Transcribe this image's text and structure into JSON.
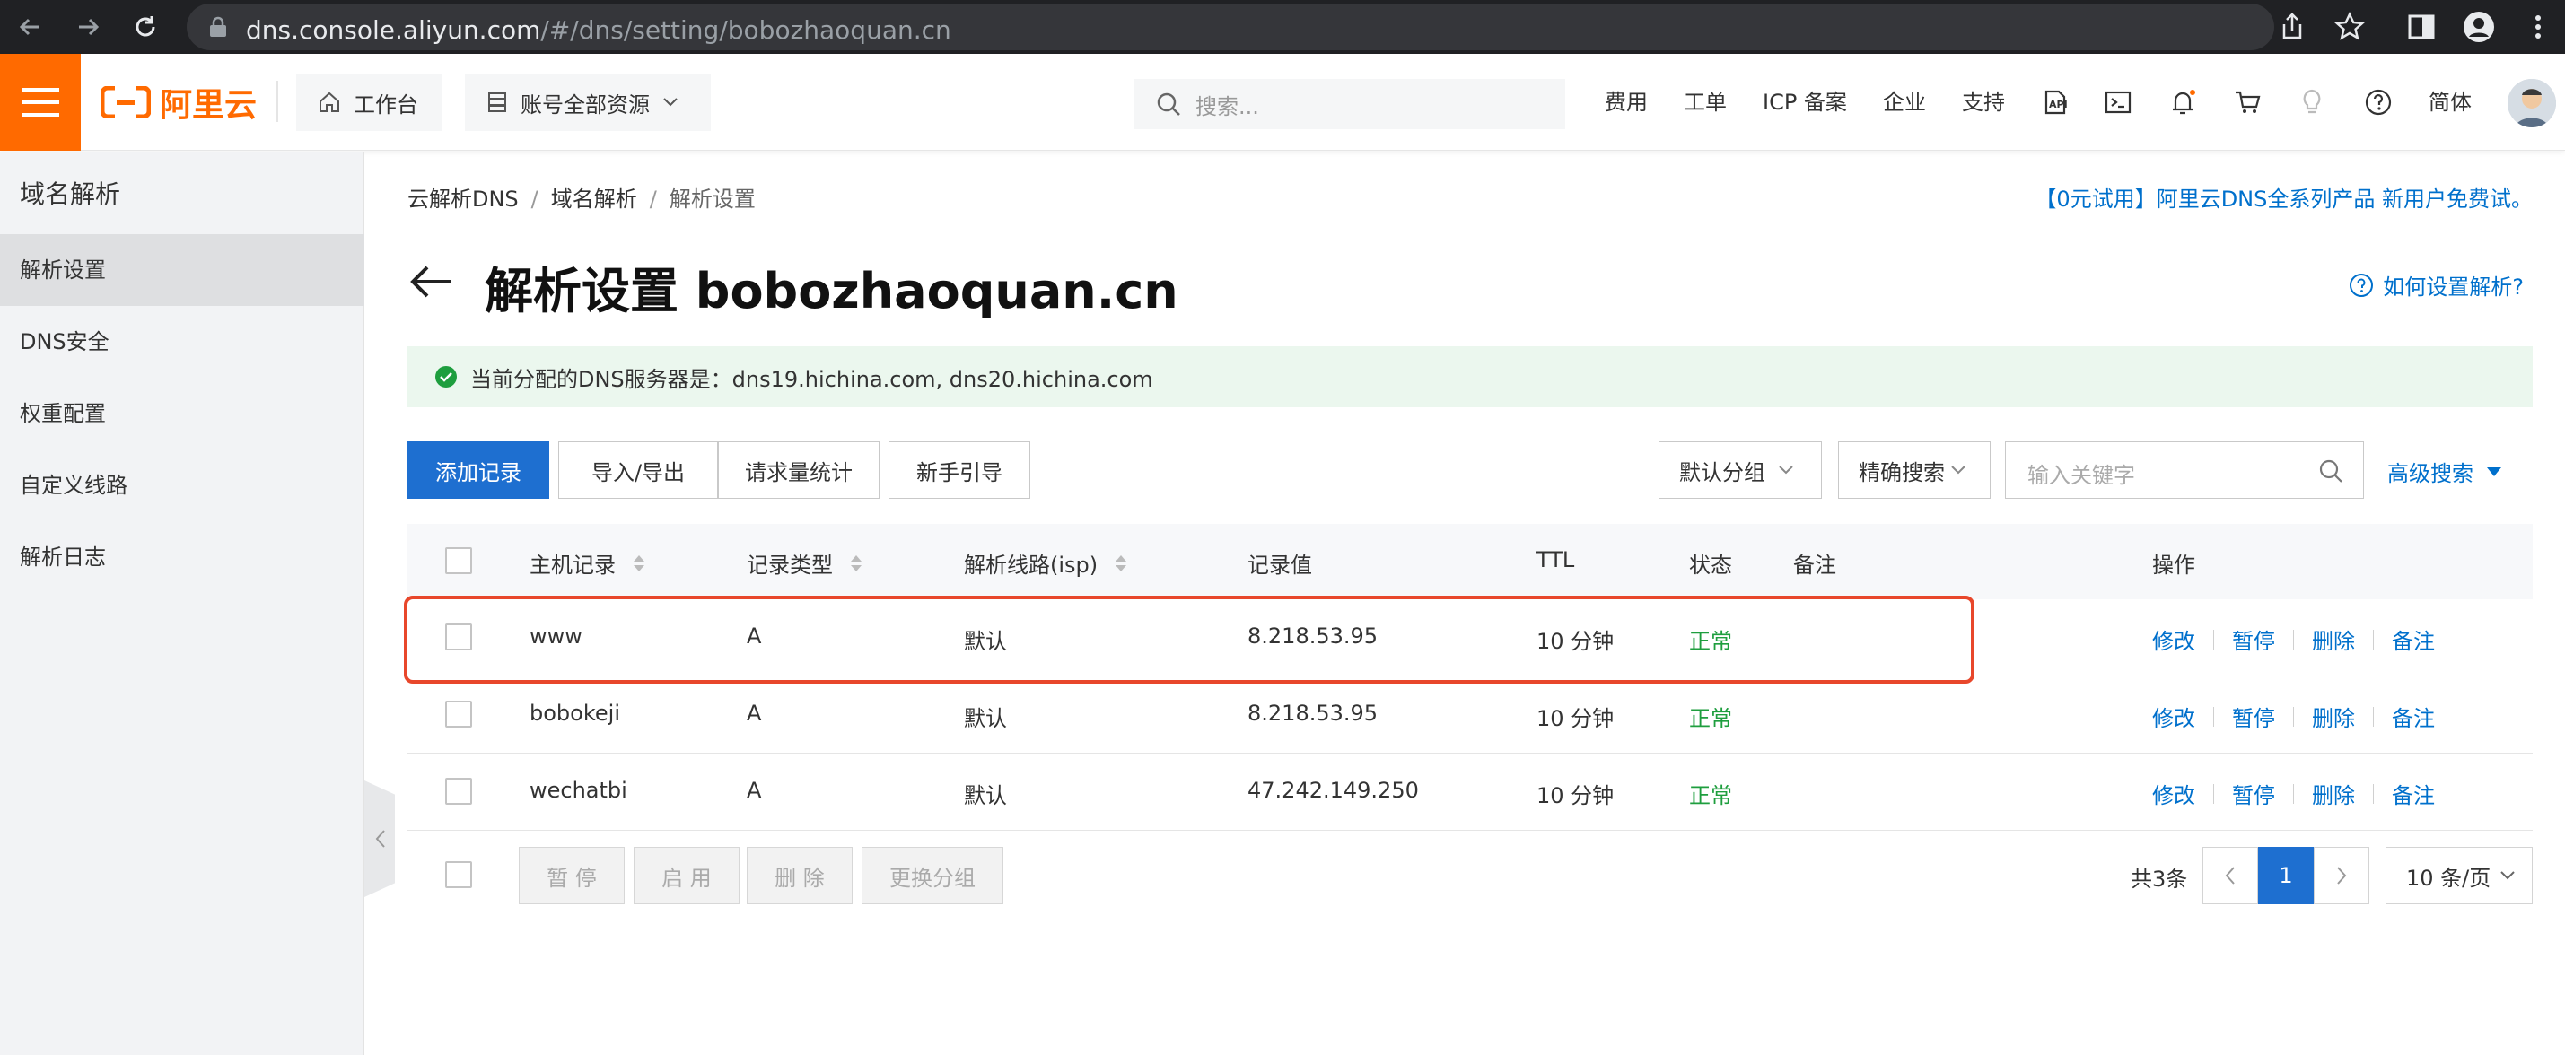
{
  "browser": {
    "url_host": "dns.console.aliyun.com",
    "url_path": "/#/dns/setting/bobozhaoquan.cn"
  },
  "header": {
    "logo_text": "阿里云",
    "workbench": "工作台",
    "resources": "账号全部资源",
    "search_placeholder": "搜索...",
    "links": [
      "费用",
      "工单",
      "ICP 备案",
      "企业",
      "支持"
    ],
    "lang": "简体"
  },
  "sidebar": {
    "title": "域名解析",
    "items": [
      "解析设置",
      "DNS安全",
      "权重配置",
      "自定义线路",
      "解析日志"
    ]
  },
  "breadcrumb": [
    "云解析DNS",
    "域名解析",
    "解析设置"
  ],
  "promo": "【0元试用】阿里云DNS全系列产品 新用户免费试。",
  "page": {
    "title": "解析设置 bobozhaoquan.cn",
    "help": "如何设置解析?",
    "alert": "当前分配的DNS服务器是：dns19.hichina.com, dns20.hichina.com"
  },
  "toolbar": {
    "add": "添加记录",
    "import_export": "导入/导出",
    "stats": "请求量统计",
    "guide": "新手引导",
    "group": "默认分组",
    "exact": "精确搜索",
    "keyword_placeholder": "输入关键字",
    "advanced": "高级搜索"
  },
  "table": {
    "headers": [
      "主机记录",
      "记录类型",
      "解析线路(isp)",
      "记录值",
      "TTL",
      "状态",
      "备注",
      "操作"
    ],
    "rows": [
      {
        "host": "www",
        "type": "A",
        "line": "默认",
        "value": "8.218.53.95",
        "ttl": "10 分钟",
        "status": "正常"
      },
      {
        "host": "bobokeji",
        "type": "A",
        "line": "默认",
        "value": "8.218.53.95",
        "ttl": "10 分钟",
        "status": "正常"
      },
      {
        "host": "wechatbi",
        "type": "A",
        "line": "默认",
        "value": "47.242.149.250",
        "ttl": "10 分钟",
        "status": "正常"
      }
    ],
    "ops": [
      "修改",
      "暂停",
      "删除",
      "备注"
    ]
  },
  "footer": {
    "pause": "暂 停",
    "enable": "启 用",
    "delete": "删 除",
    "change_group": "更换分组",
    "total": "共3条",
    "current_page": "1",
    "page_size": "10 条/页"
  },
  "colors": {
    "brand": "#ff6a00",
    "primary": "#1e6fd0",
    "link": "#0070cc",
    "success": "#1e9e3e",
    "highlight": "#e8472b"
  }
}
